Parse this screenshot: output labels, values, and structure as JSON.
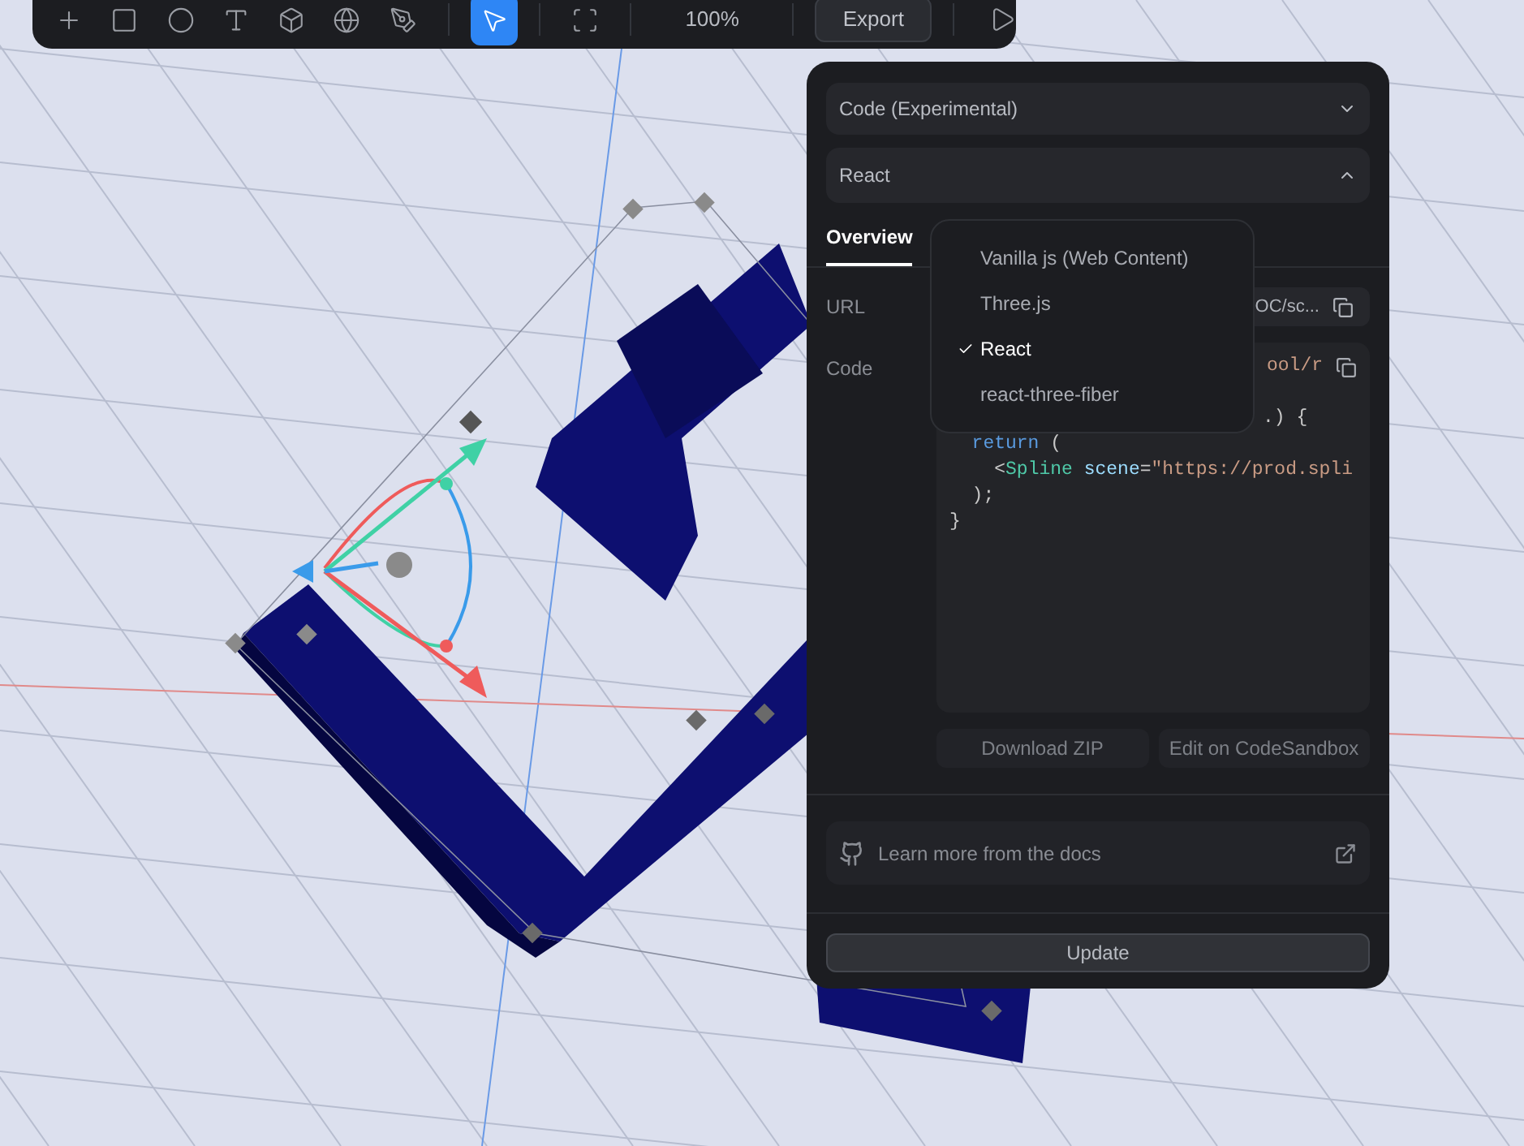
{
  "toolbar": {
    "tools": [
      {
        "kind": "plus",
        "selected": false
      },
      {
        "kind": "rectangle",
        "selected": false
      },
      {
        "kind": "ellipse",
        "selected": false
      },
      {
        "kind": "text",
        "selected": false
      },
      {
        "kind": "cube",
        "selected": false
      },
      {
        "kind": "sphere",
        "selected": false
      },
      {
        "kind": "pen",
        "selected": false
      },
      {
        "kind": "pointer",
        "selected": true
      },
      {
        "kind": "frame",
        "selected": false
      }
    ],
    "zoom": "100%",
    "export_button": "Export"
  },
  "panel": {
    "export_type": "Code (Experimental)",
    "framework": {
      "value": "React",
      "expanded": true
    },
    "tabs": [
      {
        "label": "Overview",
        "selected": true
      }
    ],
    "url": {
      "label": "URL",
      "value": "OC/sc..."
    },
    "code": {
      "label": "Code",
      "path": "ool/r",
      "lines": [
        {
          "kind": "partial",
          "tokens": [
            {
              "text": ".) {",
              "kind": "plain"
            }
          ]
        },
        {
          "kind": "full",
          "tokens": [
            {
              "text": "  return",
              "kind": "keyword"
            },
            {
              "text": " (",
              "kind": "plain"
            }
          ]
        },
        {
          "kind": "full",
          "tokens": [
            {
              "text": "    <",
              "kind": "plain"
            },
            {
              "text": "Spline",
              "kind": "tag"
            },
            {
              "text": " scene",
              "kind": "attr"
            },
            {
              "text": "=",
              "kind": "plain"
            },
            {
              "text": "\"https://prod.spli",
              "kind": "string"
            }
          ]
        },
        {
          "kind": "full",
          "tokens": [
            {
              "text": "  );",
              "kind": "plain"
            }
          ]
        },
        {
          "kind": "full",
          "tokens": [
            {
              "text": "}",
              "kind": "plain"
            }
          ]
        }
      ]
    },
    "buttons": [
      "Download ZIP",
      "Edit on CodeSandbox"
    ],
    "docs_link": "Learn more from the docs",
    "update_button": "Update"
  },
  "menu": {
    "items": [
      {
        "label": "Vanilla js (Web Content)",
        "selected": false
      },
      {
        "label": "Three.js",
        "selected": false
      },
      {
        "label": "React",
        "selected": true
      },
      {
        "label": "react-three-fiber",
        "selected": false
      }
    ]
  }
}
